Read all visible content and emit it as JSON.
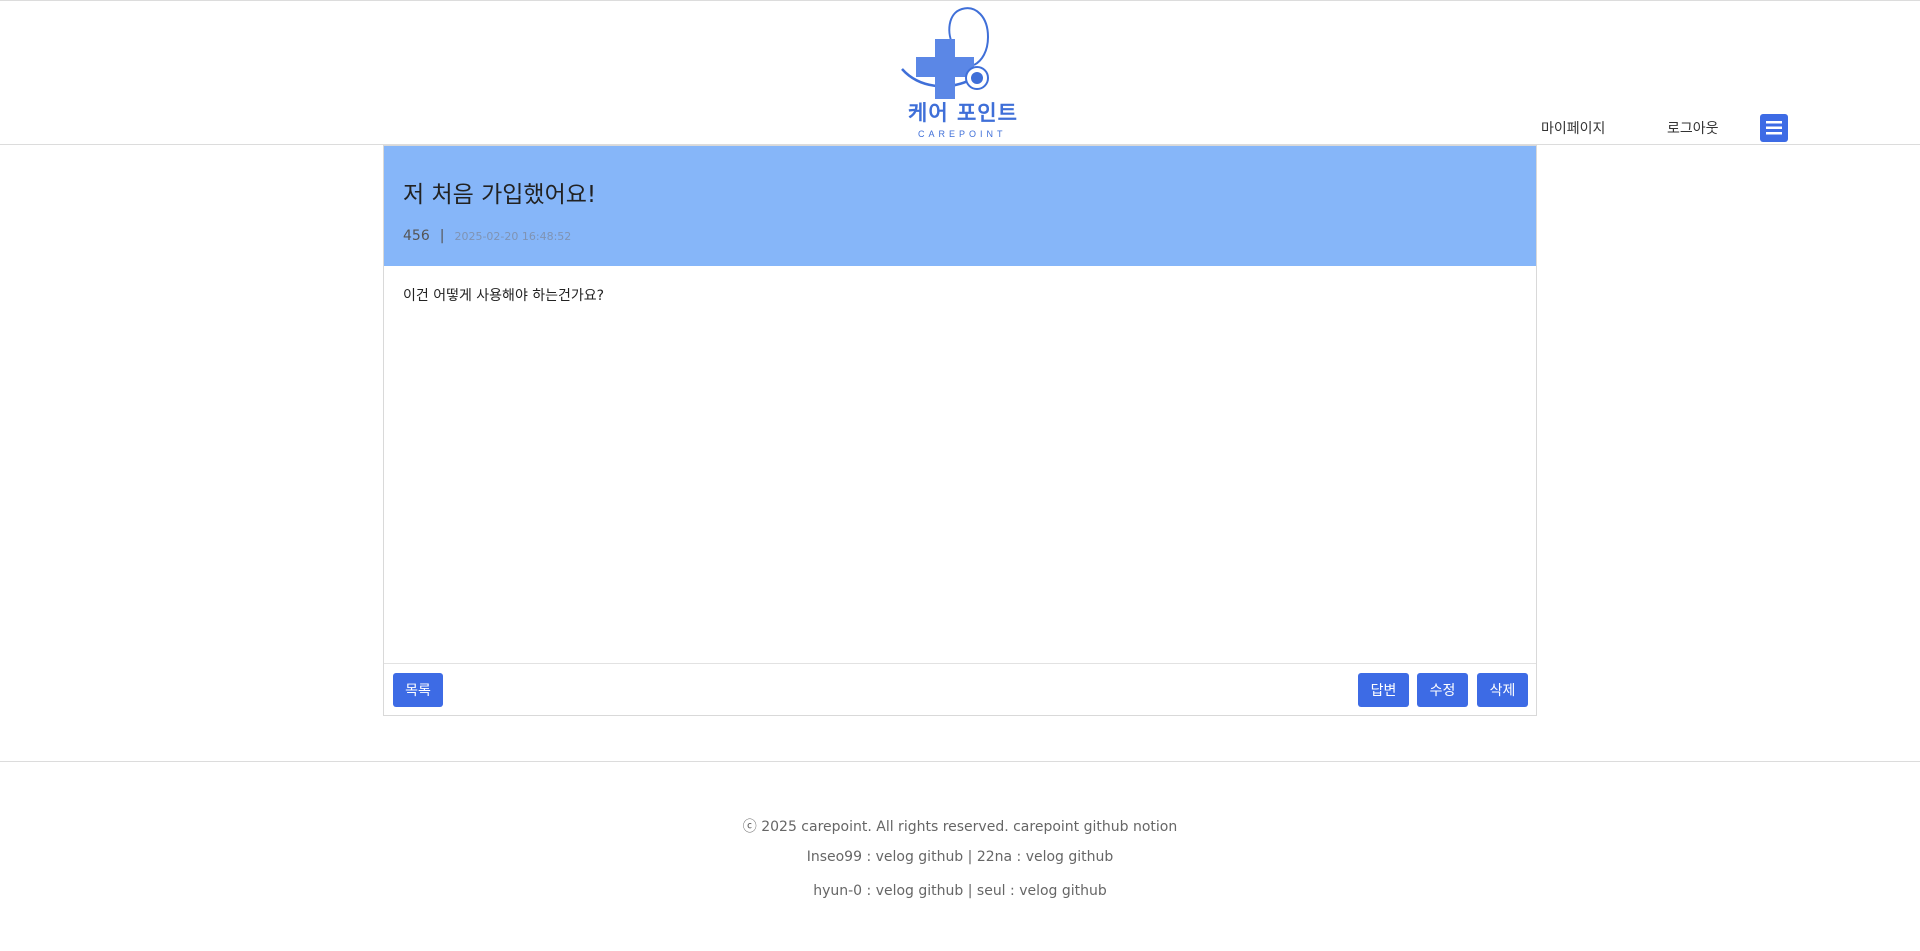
{
  "header": {
    "logo_text": "케어 포인트",
    "logo_sub": "CAREPOINT",
    "nav_mypage": "마이페이지",
    "nav_logout": "로그아웃",
    "menu_icon": "hamburger-icon",
    "brand_color": "#3d6be5"
  },
  "post": {
    "title": "저 처음 가입했어요!",
    "author": "456",
    "separator": "|",
    "date": "2025-02-20 16:48:52",
    "content": "이건 어떻게 사용해야 하는건가요?",
    "header_color": "#86b6f9"
  },
  "actions": {
    "list_label": "목록",
    "reply_label": "답변",
    "edit_label": "수정",
    "delete_label": "삭제"
  },
  "footer": {
    "line1": "ⓒ 2025 carepoint. All rights reserved. carepoint github notion",
    "line2": "Inseo99 : velog github | 22na : velog github",
    "line3": "hyun-0 : velog github | seul : velog github"
  }
}
